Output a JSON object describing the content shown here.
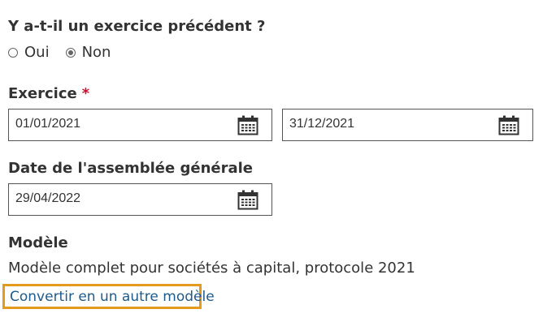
{
  "previous_exercise": {
    "question": "Y a-t-il un exercice précédent ?",
    "options": [
      {
        "label": "Oui",
        "selected": false
      },
      {
        "label": "Non",
        "selected": true
      }
    ]
  },
  "exercise": {
    "label": "Exercice",
    "required_marker": "*",
    "start_date": "01/01/2021",
    "end_date": "31/12/2021"
  },
  "general_assembly": {
    "label": "Date de l'assemblée générale",
    "date": "29/04/2022"
  },
  "model": {
    "label": "Modèle",
    "value": "Modèle complet pour sociétés à capital, protocole 2021",
    "convert_link": "Convertir en un autre modèle"
  },
  "colors": {
    "text": "#333333",
    "required": "#c8102e",
    "link": "#1f5a8a",
    "focus_outline": "#e39a1d"
  },
  "icons": {
    "date_picker": "calendar-icon"
  }
}
